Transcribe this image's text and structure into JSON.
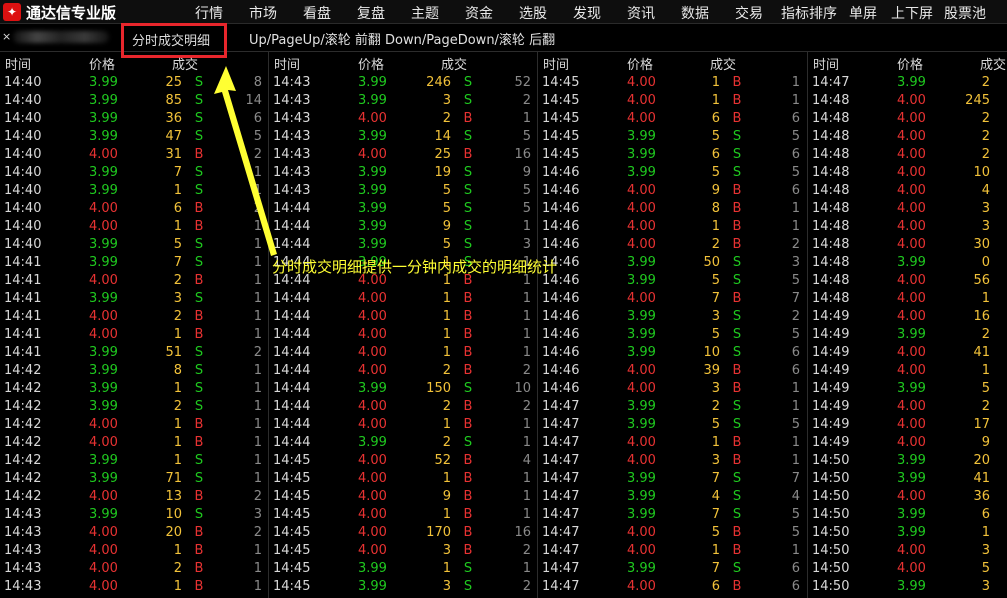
{
  "app": {
    "title": "通达信专业版"
  },
  "menu": [
    "行情",
    "市场",
    "看盘",
    "复盘",
    "主题",
    "资金",
    "选股",
    "发现",
    "资讯",
    "数据",
    "交易",
    "指标排序",
    "单屏",
    "上下屏",
    "股票池"
  ],
  "infobar": {
    "close": "×",
    "page_title": "分时成交明细",
    "nav_hint": "Up/PageUp/滚轮 前翻 Down/PageDown/滚轮 后翻"
  },
  "annotation": {
    "text": "分时成交明细提供一分钟内成交的明细统计"
  },
  "headers": {
    "time": "时间",
    "price": "价格",
    "volume": "成交"
  },
  "columns": [
    {
      "rows": [
        [
          "14:40",
          "3.99",
          "25",
          "S",
          "8"
        ],
        [
          "14:40",
          "3.99",
          "85",
          "S",
          "14"
        ],
        [
          "14:40",
          "3.99",
          "36",
          "S",
          "6"
        ],
        [
          "14:40",
          "3.99",
          "47",
          "S",
          "5"
        ],
        [
          "14:40",
          "4.00",
          "31",
          "B",
          "2"
        ],
        [
          "14:40",
          "3.99",
          "7",
          "S",
          "1"
        ],
        [
          "14:40",
          "3.99",
          "1",
          "S",
          "1"
        ],
        [
          "14:40",
          "4.00",
          "6",
          "B",
          "2"
        ],
        [
          "14:40",
          "4.00",
          "1",
          "B",
          "1"
        ],
        [
          "14:40",
          "3.99",
          "5",
          "S",
          "1"
        ],
        [
          "14:41",
          "3.99",
          "7",
          "S",
          "1"
        ],
        [
          "14:41",
          "4.00",
          "2",
          "B",
          "1"
        ],
        [
          "14:41",
          "3.99",
          "3",
          "S",
          "1"
        ],
        [
          "14:41",
          "4.00",
          "2",
          "B",
          "1"
        ],
        [
          "14:41",
          "4.00",
          "1",
          "B",
          "1"
        ],
        [
          "14:41",
          "3.99",
          "51",
          "S",
          "2"
        ],
        [
          "14:42",
          "3.99",
          "8",
          "S",
          "1"
        ],
        [
          "14:42",
          "3.99",
          "1",
          "S",
          "1"
        ],
        [
          "14:42",
          "3.99",
          "2",
          "S",
          "1"
        ],
        [
          "14:42",
          "4.00",
          "1",
          "B",
          "1"
        ],
        [
          "14:42",
          "4.00",
          "1",
          "B",
          "1"
        ],
        [
          "14:42",
          "3.99",
          "1",
          "S",
          "1"
        ],
        [
          "14:42",
          "3.99",
          "71",
          "S",
          "1"
        ],
        [
          "14:42",
          "4.00",
          "13",
          "B",
          "2"
        ],
        [
          "14:43",
          "3.99",
          "10",
          "S",
          "3"
        ],
        [
          "14:43",
          "4.00",
          "20",
          "B",
          "2"
        ],
        [
          "14:43",
          "4.00",
          "1",
          "B",
          "1"
        ],
        [
          "14:43",
          "4.00",
          "2",
          "B",
          "1"
        ],
        [
          "14:43",
          "4.00",
          "1",
          "B",
          "1"
        ]
      ]
    },
    {
      "rows": [
        [
          "14:43",
          "3.99",
          "246",
          "S",
          "52"
        ],
        [
          "14:43",
          "3.99",
          "3",
          "S",
          "2"
        ],
        [
          "14:43",
          "4.00",
          "2",
          "B",
          "1"
        ],
        [
          "14:43",
          "3.99",
          "14",
          "S",
          "5"
        ],
        [
          "14:43",
          "4.00",
          "25",
          "B",
          "16"
        ],
        [
          "14:43",
          "3.99",
          "19",
          "S",
          "9"
        ],
        [
          "14:43",
          "3.99",
          "5",
          "S",
          "5"
        ],
        [
          "14:44",
          "3.99",
          "5",
          "S",
          "5"
        ],
        [
          "14:44",
          "3.99",
          "9",
          "S",
          "1"
        ],
        [
          "14:44",
          "3.99",
          "5",
          "S",
          "3"
        ],
        [
          "14:44",
          "3.99",
          "1",
          "S",
          "1"
        ],
        [
          "14:44",
          "4.00",
          "1",
          "B",
          "1"
        ],
        [
          "14:44",
          "4.00",
          "1",
          "B",
          "1"
        ],
        [
          "14:44",
          "4.00",
          "1",
          "B",
          "1"
        ],
        [
          "14:44",
          "4.00",
          "1",
          "B",
          "1"
        ],
        [
          "14:44",
          "4.00",
          "1",
          "B",
          "1"
        ],
        [
          "14:44",
          "4.00",
          "2",
          "B",
          "2"
        ],
        [
          "14:44",
          "3.99",
          "150",
          "S",
          "10"
        ],
        [
          "14:44",
          "4.00",
          "2",
          "B",
          "2"
        ],
        [
          "14:44",
          "4.00",
          "1",
          "B",
          "1"
        ],
        [
          "14:44",
          "3.99",
          "2",
          "S",
          "1"
        ],
        [
          "14:45",
          "4.00",
          "52",
          "B",
          "4"
        ],
        [
          "14:45",
          "4.00",
          "1",
          "B",
          "1"
        ],
        [
          "14:45",
          "4.00",
          "9",
          "B",
          "1"
        ],
        [
          "14:45",
          "4.00",
          "1",
          "B",
          "1"
        ],
        [
          "14:45",
          "4.00",
          "170",
          "B",
          "16"
        ],
        [
          "14:45",
          "4.00",
          "3",
          "B",
          "2"
        ],
        [
          "14:45",
          "3.99",
          "1",
          "S",
          "1"
        ],
        [
          "14:45",
          "3.99",
          "3",
          "S",
          "2"
        ]
      ]
    },
    {
      "rows": [
        [
          "14:45",
          "4.00",
          "1",
          "B",
          "1"
        ],
        [
          "14:45",
          "4.00",
          "1",
          "B",
          "1"
        ],
        [
          "14:45",
          "4.00",
          "6",
          "B",
          "6"
        ],
        [
          "14:45",
          "3.99",
          "5",
          "S",
          "5"
        ],
        [
          "14:45",
          "3.99",
          "6",
          "S",
          "6"
        ],
        [
          "14:46",
          "3.99",
          "5",
          "S",
          "5"
        ],
        [
          "14:46",
          "4.00",
          "9",
          "B",
          "6"
        ],
        [
          "14:46",
          "4.00",
          "8",
          "B",
          "1"
        ],
        [
          "14:46",
          "4.00",
          "1",
          "B",
          "1"
        ],
        [
          "14:46",
          "4.00",
          "2",
          "B",
          "2"
        ],
        [
          "14:46",
          "3.99",
          "50",
          "S",
          "3"
        ],
        [
          "14:46",
          "3.99",
          "5",
          "S",
          "5"
        ],
        [
          "14:46",
          "4.00",
          "7",
          "B",
          "7"
        ],
        [
          "14:46",
          "3.99",
          "3",
          "S",
          "2"
        ],
        [
          "14:46",
          "3.99",
          "5",
          "S",
          "5"
        ],
        [
          "14:46",
          "3.99",
          "10",
          "S",
          "6"
        ],
        [
          "14:46",
          "4.00",
          "39",
          "B",
          "6"
        ],
        [
          "14:46",
          "4.00",
          "3",
          "B",
          "1"
        ],
        [
          "14:47",
          "3.99",
          "2",
          "S",
          "1"
        ],
        [
          "14:47",
          "3.99",
          "5",
          "S",
          "5"
        ],
        [
          "14:47",
          "4.00",
          "1",
          "B",
          "1"
        ],
        [
          "14:47",
          "4.00",
          "3",
          "B",
          "1"
        ],
        [
          "14:47",
          "3.99",
          "7",
          "S",
          "7"
        ],
        [
          "14:47",
          "3.99",
          "4",
          "S",
          "4"
        ],
        [
          "14:47",
          "3.99",
          "7",
          "S",
          "5"
        ],
        [
          "14:47",
          "4.00",
          "5",
          "B",
          "5"
        ],
        [
          "14:47",
          "4.00",
          "1",
          "B",
          "1"
        ],
        [
          "14:47",
          "3.99",
          "7",
          "S",
          "6"
        ],
        [
          "14:47",
          "4.00",
          "6",
          "B",
          "6"
        ]
      ]
    },
    {
      "rows": [
        [
          "14:47",
          "3.99",
          "2",
          null,
          null
        ],
        [
          "14:48",
          "4.00",
          "245",
          null,
          null
        ],
        [
          "14:48",
          "4.00",
          "2",
          null,
          null
        ],
        [
          "14:48",
          "4.00",
          "2",
          null,
          null
        ],
        [
          "14:48",
          "4.00",
          "2",
          null,
          null
        ],
        [
          "14:48",
          "4.00",
          "10",
          null,
          null
        ],
        [
          "14:48",
          "4.00",
          "4",
          null,
          null
        ],
        [
          "14:48",
          "4.00",
          "3",
          null,
          null
        ],
        [
          "14:48",
          "4.00",
          "3",
          null,
          null
        ],
        [
          "14:48",
          "4.00",
          "30",
          null,
          null
        ],
        [
          "14:48",
          "3.99",
          "0",
          null,
          null
        ],
        [
          "14:48",
          "4.00",
          "56",
          null,
          null
        ],
        [
          "14:48",
          "4.00",
          "1",
          null,
          null
        ],
        [
          "14:49",
          "4.00",
          "16",
          null,
          null
        ],
        [
          "14:49",
          "3.99",
          "2",
          null,
          null
        ],
        [
          "14:49",
          "4.00",
          "41",
          null,
          null
        ],
        [
          "14:49",
          "4.00",
          "1",
          null,
          null
        ],
        [
          "14:49",
          "3.99",
          "5",
          null,
          null
        ],
        [
          "14:49",
          "4.00",
          "2",
          null,
          null
        ],
        [
          "14:49",
          "4.00",
          "17",
          null,
          null
        ],
        [
          "14:49",
          "4.00",
          "9",
          null,
          null
        ],
        [
          "14:50",
          "3.99",
          "20",
          null,
          null
        ],
        [
          "14:50",
          "3.99",
          "41",
          null,
          null
        ],
        [
          "14:50",
          "4.00",
          "36",
          null,
          null
        ],
        [
          "14:50",
          "3.99",
          "6",
          null,
          null
        ],
        [
          "14:50",
          "3.99",
          "1",
          null,
          null
        ],
        [
          "14:50",
          "4.00",
          "3",
          null,
          null
        ],
        [
          "14:50",
          "4.00",
          "5",
          null,
          null
        ],
        [
          "14:50",
          "3.99",
          "3",
          null,
          null
        ]
      ]
    }
  ]
}
